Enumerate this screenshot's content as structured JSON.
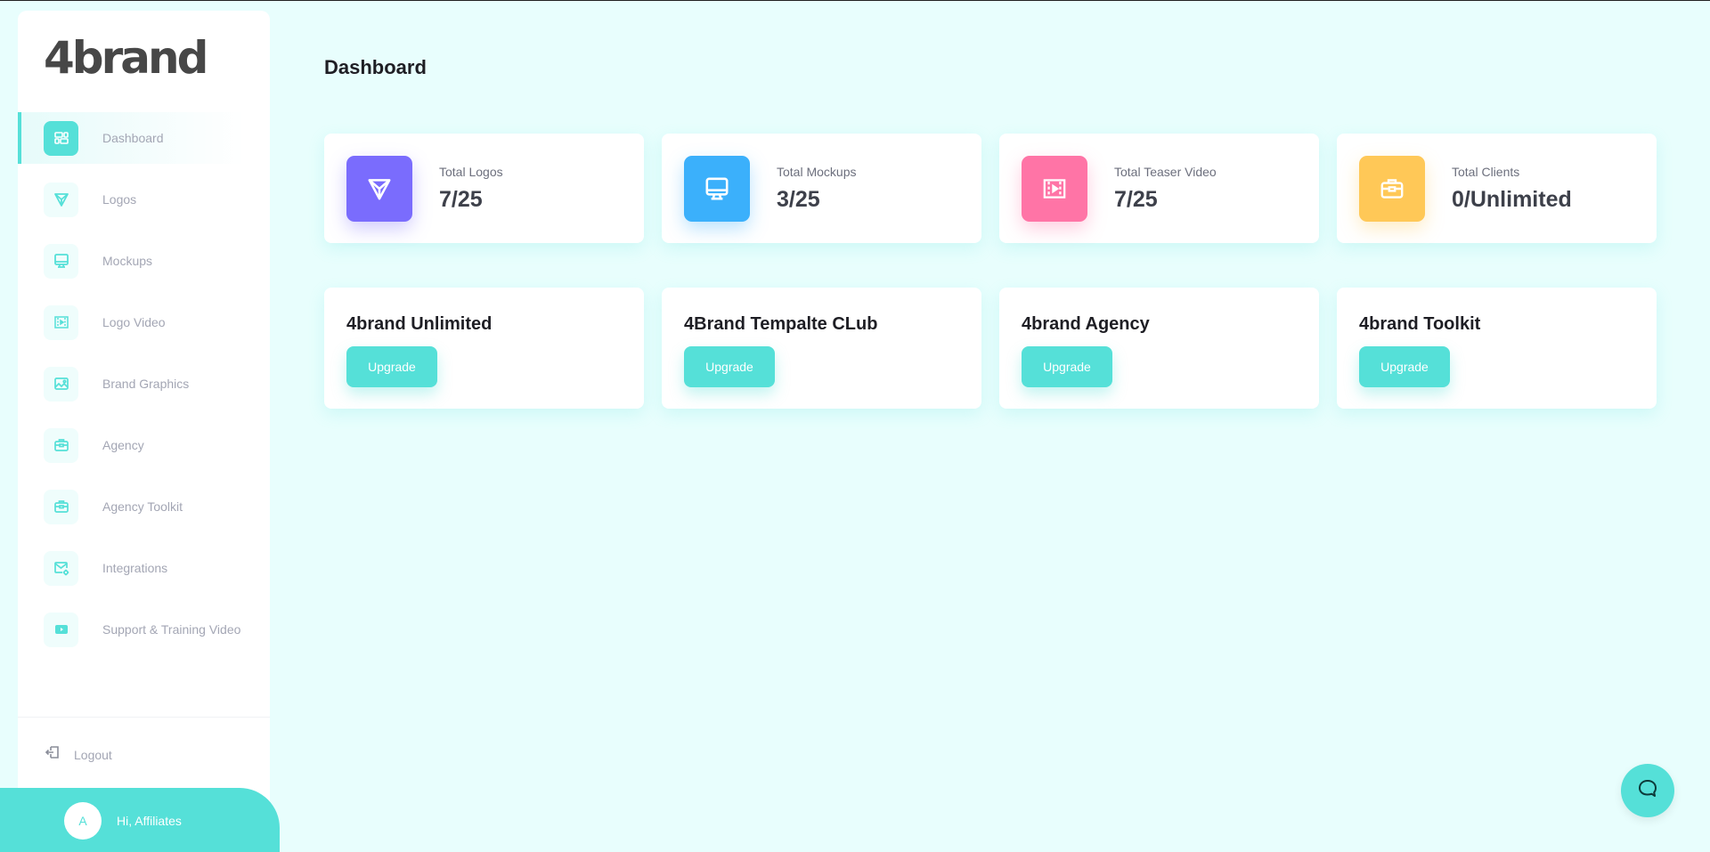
{
  "brand": {
    "logo_text": "4brand"
  },
  "colors": {
    "accent": "#55e0d8",
    "logos": "#7a6cfd",
    "mockups": "#3bb0fb",
    "teaser": "#ff74a6",
    "clients": "#ffc857"
  },
  "sidebar": {
    "items": [
      {
        "label": "Dashboard",
        "icon": "dashboard-icon",
        "active": true
      },
      {
        "label": "Logos",
        "icon": "logos-icon"
      },
      {
        "label": "Mockups",
        "icon": "monitor-icon"
      },
      {
        "label": "Logo Video",
        "icon": "video-icon"
      },
      {
        "label": "Brand Graphics",
        "icon": "image-icon"
      },
      {
        "label": "Agency",
        "icon": "briefcase-icon"
      },
      {
        "label": "Agency Toolkit",
        "icon": "briefcase-icon"
      },
      {
        "label": "Integrations",
        "icon": "mail-settings-icon"
      },
      {
        "label": "Support & Training Video",
        "icon": "youtube-icon"
      }
    ],
    "logout_label": "Logout",
    "user": {
      "avatar_initial": "A",
      "greeting": "Hi, Affiliates"
    }
  },
  "main": {
    "title": "Dashboard",
    "stats": [
      {
        "label": "Total Logos",
        "value": "7/25",
        "icon": "logos-icon"
      },
      {
        "label": "Total Mockups",
        "value": "3/25",
        "icon": "monitor-icon"
      },
      {
        "label": "Total Teaser Video",
        "value": "7/25",
        "icon": "video-icon"
      },
      {
        "label": "Total Clients",
        "value": "0/Unlimited",
        "icon": "briefcase-icon"
      }
    ],
    "plans": [
      {
        "title": "4brand Unlimited",
        "button": "Upgrade"
      },
      {
        "title": "4Brand Tempalte CLub",
        "button": "Upgrade"
      },
      {
        "title": "4brand Agency",
        "button": "Upgrade"
      },
      {
        "title": "4brand Toolkit",
        "button": "Upgrade"
      }
    ]
  },
  "chat": {
    "icon": "chat-icon"
  }
}
